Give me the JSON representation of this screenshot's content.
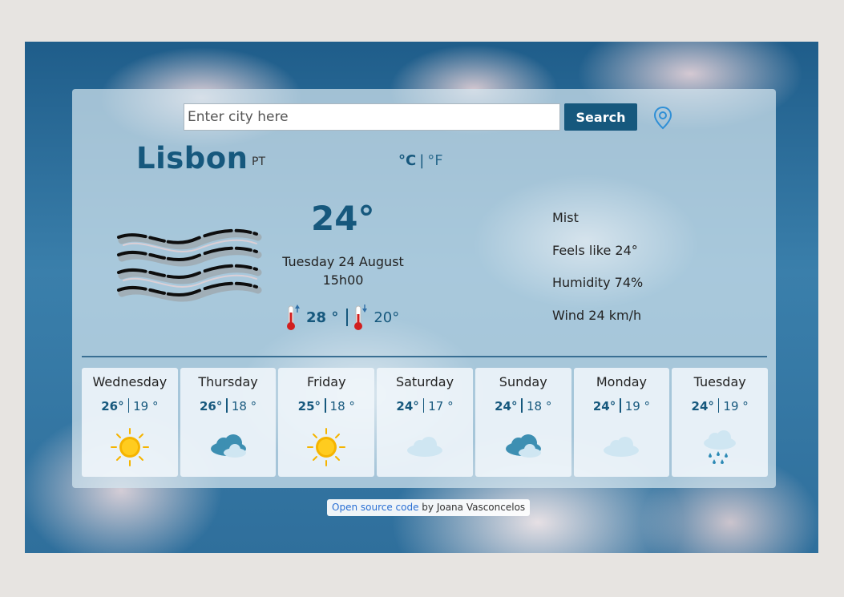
{
  "search": {
    "placeholder": "Enter city here",
    "button_label": "Search"
  },
  "location": {
    "city": "Lisbon",
    "country": "PT"
  },
  "units": {
    "celsius": "°C",
    "separator": "|",
    "fahrenheit": "°F"
  },
  "current": {
    "icon": "mist-icon",
    "temperature": "24°",
    "date": "Tuesday 24 August",
    "time": "15h00",
    "max": "28 °",
    "min": "20°",
    "description": "Mist",
    "feels_like": "Feels like 24°",
    "humidity": "Humidity 74%",
    "wind": "Wind 24 km/h"
  },
  "forecast": [
    {
      "day": "Wednesday",
      "max": "26°",
      "min": "19 °",
      "icon": "sun-icon"
    },
    {
      "day": "Thursday",
      "max": "26°",
      "min": "18 °",
      "icon": "sun-cloud-icon"
    },
    {
      "day": "Friday",
      "max": "25°",
      "min": "18 °",
      "icon": "sun-icon"
    },
    {
      "day": "Saturday",
      "max": "24°",
      "min": "17 °",
      "icon": "cloud-icon"
    },
    {
      "day": "Sunday",
      "max": "24°",
      "min": "18 °",
      "icon": "sun-cloud-icon"
    },
    {
      "day": "Monday",
      "max": "24°",
      "min": "19 °",
      "icon": "cloud-icon"
    },
    {
      "day": "Tuesday",
      "max": "24°",
      "min": "19 °",
      "icon": "rain-icon"
    }
  ],
  "footer": {
    "link_text": "Open source code",
    "by_text": " by Joana Vasconcelos"
  },
  "colors": {
    "accent": "#16587d",
    "sun": "#f5b400",
    "cloud": "#cfe6f2",
    "cloud_dark": "#3d8fb2",
    "thermometer": "#d11f1f"
  }
}
